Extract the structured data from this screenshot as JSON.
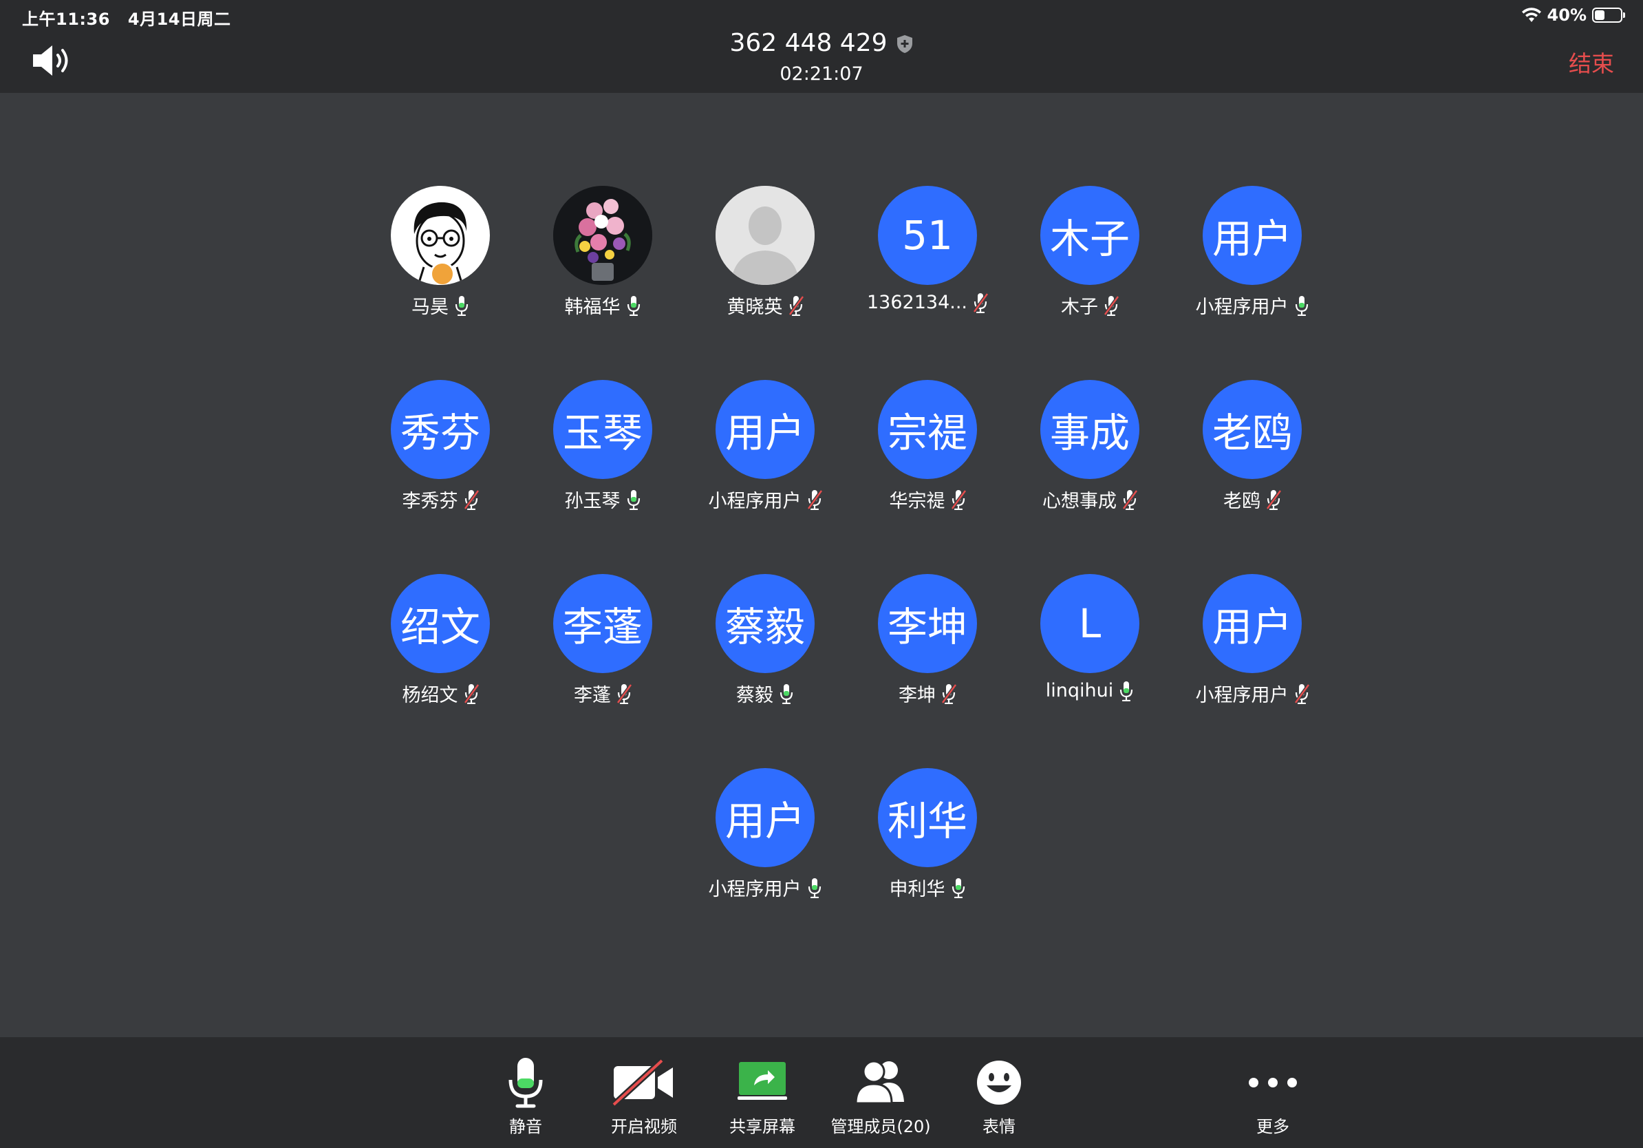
{
  "status_bar": {
    "time": "上午11:36",
    "date": "4月14日周二",
    "battery": "40%",
    "battery_level": 0.4
  },
  "header": {
    "meeting_id": "362 448 429",
    "duration": "02:21:07",
    "end_label": "结束"
  },
  "participants": [
    [
      {
        "avatar": "",
        "avatar_type": "photo-white",
        "name": "马昊",
        "mic": "on",
        "host": true
      },
      {
        "avatar": "",
        "avatar_type": "photo-dark",
        "name": "韩福华",
        "mic": "on"
      },
      {
        "avatar": "",
        "avatar_type": "photo-grey",
        "name": "黄晓英",
        "mic": "muted"
      },
      {
        "avatar": "51",
        "avatar_type": "text",
        "name": "1362134...",
        "mic": "muted"
      },
      {
        "avatar": "木子",
        "avatar_type": "text",
        "name": "木子",
        "mic": "muted"
      },
      {
        "avatar": "用户",
        "avatar_type": "text",
        "name": "小程序用户",
        "mic": "on"
      }
    ],
    [
      {
        "avatar": "秀芬",
        "avatar_type": "text",
        "name": "李秀芬",
        "mic": "muted"
      },
      {
        "avatar": "玉琴",
        "avatar_type": "text",
        "name": "孙玉琴",
        "mic": "on"
      },
      {
        "avatar": "用户",
        "avatar_type": "text",
        "name": "小程序用户",
        "mic": "muted"
      },
      {
        "avatar": "宗禔",
        "avatar_type": "text",
        "name": "华宗禔",
        "mic": "muted"
      },
      {
        "avatar": "事成",
        "avatar_type": "text",
        "name": "心想事成",
        "mic": "muted"
      },
      {
        "avatar": "老鸥",
        "avatar_type": "text",
        "name": "老鸥",
        "mic": "muted"
      }
    ],
    [
      {
        "avatar": "绍文",
        "avatar_type": "text",
        "name": "杨绍文",
        "mic": "muted"
      },
      {
        "avatar": "李蓬",
        "avatar_type": "text",
        "name": "李蓬",
        "mic": "muted"
      },
      {
        "avatar": "蔡毅",
        "avatar_type": "text",
        "name": "蔡毅",
        "mic": "on"
      },
      {
        "avatar": "李坤",
        "avatar_type": "text",
        "name": "李坤",
        "mic": "muted"
      },
      {
        "avatar": "L",
        "avatar_type": "text",
        "name": "linqihui",
        "mic": "on"
      },
      {
        "avatar": "用户",
        "avatar_type": "text",
        "name": "小程序用户",
        "mic": "muted"
      }
    ],
    [
      {
        "avatar": "用户",
        "avatar_type": "text",
        "name": "小程序用户",
        "mic": "on"
      },
      {
        "avatar": "利华",
        "avatar_type": "text",
        "name": "申利华",
        "mic": "on"
      }
    ]
  ],
  "toolbar": {
    "mute": "静音",
    "video": "开启视频",
    "share": "共享屏幕",
    "members": "管理成员(20)",
    "emoji": "表情",
    "more": "更多"
  },
  "colors": {
    "avatar_blue": "#2f6dff",
    "end_red": "#e64d4d",
    "mic_active": "#4cd964",
    "share_green": "#3bb34a"
  }
}
